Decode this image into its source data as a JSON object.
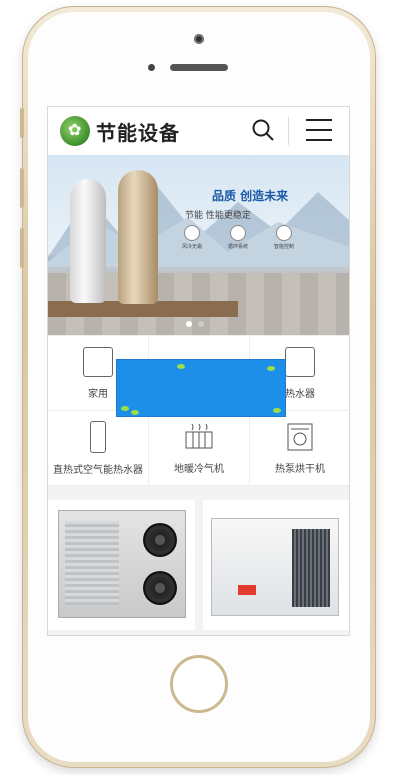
{
  "header": {
    "brand": "节能设备"
  },
  "banner": {
    "slogan": "品质 创造未来",
    "subtitle": "节能 性能更稳定",
    "features": [
      "风冷无霜",
      "循环系统",
      "智能控制"
    ]
  },
  "categories": [
    {
      "label": "家用"
    },
    {
      "label": ""
    },
    {
      "label": "热水器"
    },
    {
      "label": "直热式空气能热水器"
    },
    {
      "label": "地暖冷气机"
    },
    {
      "label": "热泵烘干机"
    }
  ]
}
